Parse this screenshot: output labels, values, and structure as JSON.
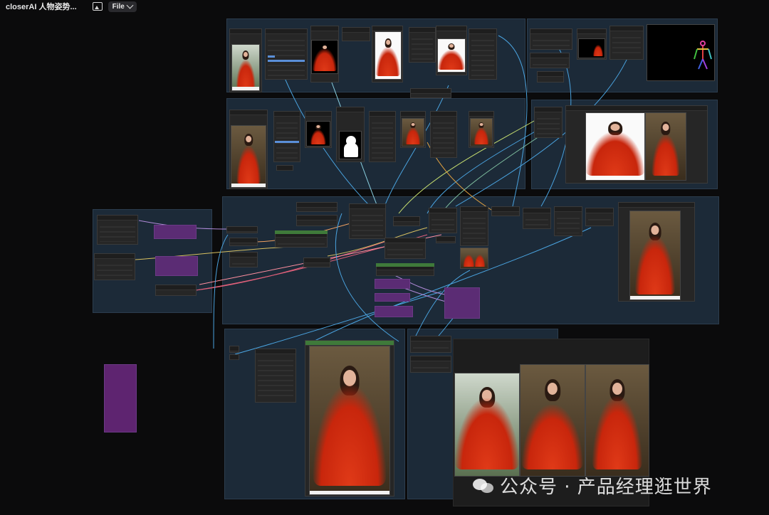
{
  "app": {
    "title": "closerAI 人物姿势...",
    "file_menu": "File",
    "image_icon": "image-icon"
  },
  "watermark": {
    "text": "公众号 · 产品经理逛世界",
    "icon": "wechat-icon"
  },
  "colors": {
    "canvas": "#0b0b0c",
    "group": "#1c2a38",
    "node": "#262626",
    "wire_blue": "#4aa3df",
    "wire_red": "#e0607a",
    "wire_yellow": "#d8c060",
    "purple_node": "#5b2c74",
    "green_node": "#3f7a3a"
  }
}
